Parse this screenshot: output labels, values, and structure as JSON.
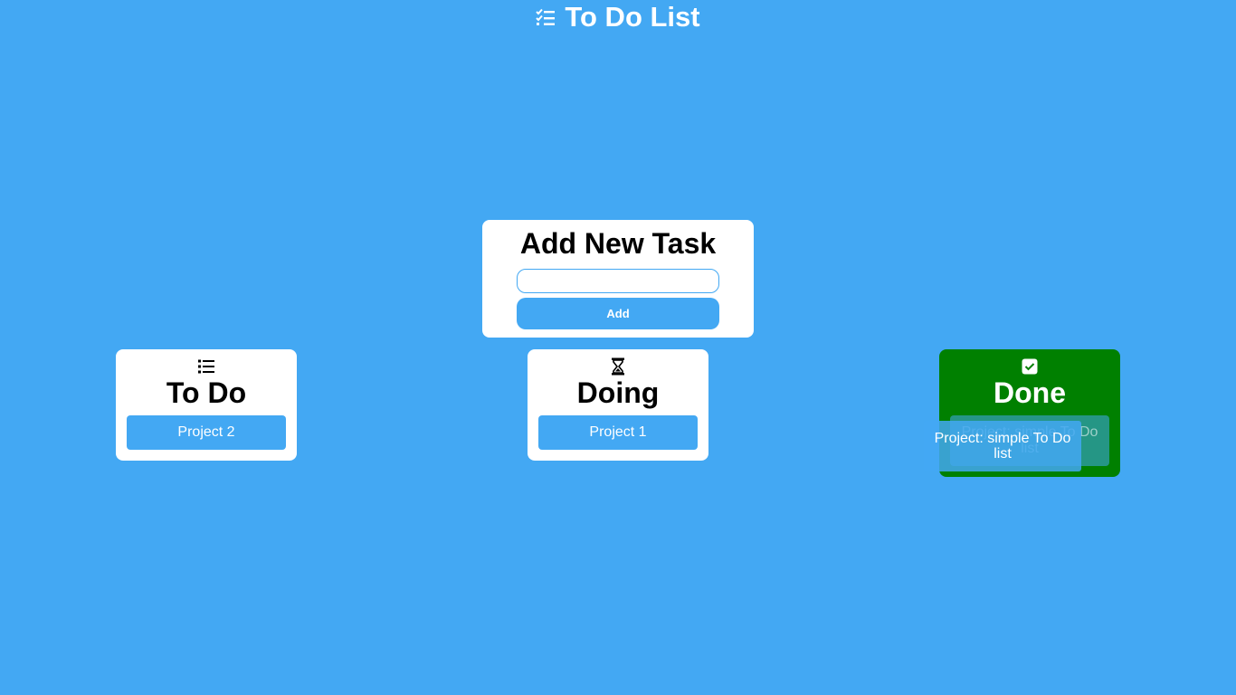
{
  "header": {
    "title": "To Do List",
    "icon": "list-check-icon"
  },
  "add_task": {
    "heading": "Add New Task",
    "input_value": "",
    "input_placeholder": "",
    "add_label": "Add"
  },
  "columns": [
    {
      "title": "To Do",
      "icon": "list-icon",
      "background": "#ffffff",
      "tasks": [
        "Project 2"
      ]
    },
    {
      "title": "Doing",
      "icon": "hourglass-icon",
      "background": "#ffffff",
      "tasks": [
        "Project 1"
      ]
    },
    {
      "title": "Done",
      "icon": "checkbox-icon",
      "background": "#008000",
      "tasks": [
        "Project: simple To Do list"
      ]
    }
  ],
  "drag_preview": {
    "label": "Project: simple To Do list"
  },
  "colors": {
    "page_background": "#43a8f3",
    "accent": "#43a8f3",
    "done_column": "#008000"
  }
}
